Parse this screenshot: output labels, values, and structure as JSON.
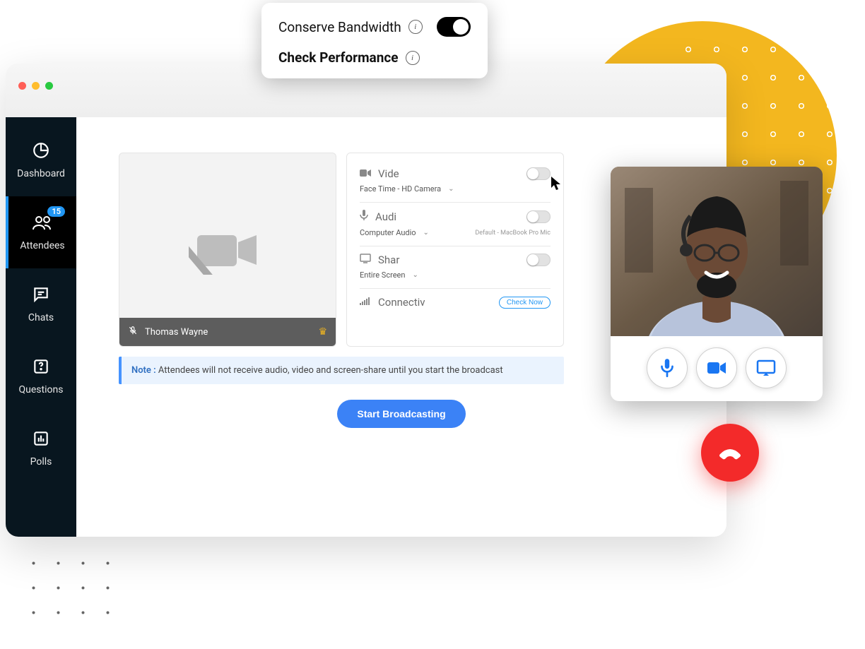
{
  "popover": {
    "row1_label": "Conserve Bandwidth",
    "row2_label": "Check Performance"
  },
  "sidebar": {
    "items": [
      {
        "label": "Dashboard"
      },
      {
        "label": "Attendees",
        "badge": "15"
      },
      {
        "label": "Chats"
      },
      {
        "label": "Questions"
      },
      {
        "label": "Polls"
      }
    ]
  },
  "preview": {
    "presenter_name": "Thomas Wayne"
  },
  "settings": {
    "video": {
      "title": "Vide",
      "device": "Face Time - HD Camera"
    },
    "audio": {
      "title": "Audi",
      "device": "Computer Audio",
      "default_label": "Default - MacBook Pro Mic"
    },
    "share": {
      "title": "Shar",
      "option": "Entire Screen"
    },
    "connectivity": {
      "title": "Connectiv",
      "check_label": "Check Now"
    }
  },
  "note": {
    "label": "Note :",
    "text": " Attendees will not receive audio, video and screen-share until you start the broadcast"
  },
  "start_button": "Start Broadcasting"
}
